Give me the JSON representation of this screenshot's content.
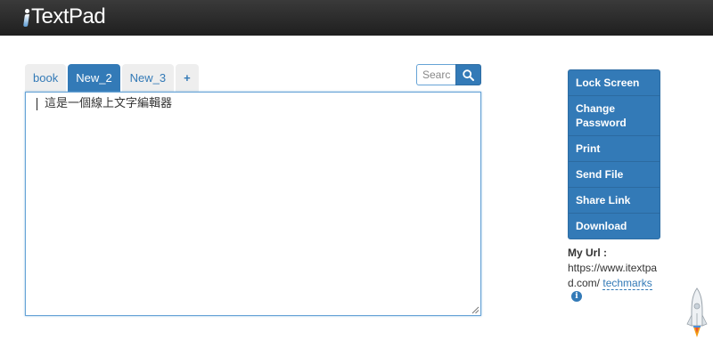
{
  "app": {
    "logo_text": "TextPad"
  },
  "tabs": [
    {
      "label": "book",
      "active": false
    },
    {
      "label": "New_2",
      "active": true
    },
    {
      "label": "New_3",
      "active": false
    },
    {
      "label": "+",
      "active": false
    }
  ],
  "search": {
    "placeholder": "Search",
    "icon": "search-icon"
  },
  "editor": {
    "content": "這是一個線上文字編輯器"
  },
  "menu": {
    "items": [
      {
        "label": "Lock Screen"
      },
      {
        "label": "Change Password"
      },
      {
        "label": "Print"
      },
      {
        "label": "Send File"
      },
      {
        "label": "Share Link"
      },
      {
        "label": "Download"
      }
    ]
  },
  "my_url": {
    "label": "My Url :",
    "url": "https://www.itextpad.com/",
    "alias": "techmarks",
    "info_icon": "info-icon"
  },
  "colors": {
    "accent": "#337ab7",
    "header_bg": "#2a2a2a",
    "tab_inactive_bg": "#eeeeee"
  }
}
